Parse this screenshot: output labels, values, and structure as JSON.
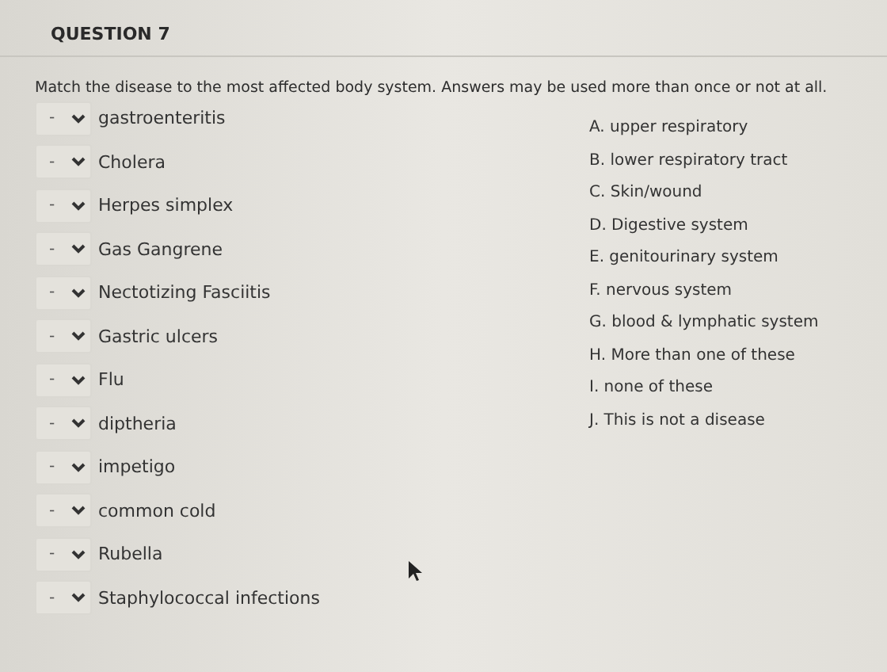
{
  "question": {
    "title": "QUESTION 7",
    "prompt": "Match the disease to the most affected body system. Answers may be used more than once or not at all.",
    "items": [
      {
        "value": "-",
        "label": "gastroenteritis"
      },
      {
        "value": "-",
        "label": "Cholera"
      },
      {
        "value": "-",
        "label": "Herpes simplex"
      },
      {
        "value": "-",
        "label": "Gas Gangrene"
      },
      {
        "value": "-",
        "label": "Nectotizing Fasciitis"
      },
      {
        "value": "-",
        "label": "Gastric ulcers"
      },
      {
        "value": "-",
        "label": "Flu"
      },
      {
        "value": "-",
        "label": "diptheria"
      },
      {
        "value": "-",
        "label": "impetigo"
      },
      {
        "value": "-",
        "label": "common cold"
      },
      {
        "value": "-",
        "label": "Rubella"
      },
      {
        "value": "-",
        "label": "Staphylococcal infections"
      }
    ],
    "answers": [
      "A. upper respiratory",
      "B. lower respiratory tract",
      "C. Skin/wound",
      "D. Digestive system",
      "E. genitourinary system",
      "F. nervous system",
      "G. blood & lymphatic system",
      "H. More than one of these",
      "I.  none of these",
      "J.  This is not a disease"
    ]
  }
}
